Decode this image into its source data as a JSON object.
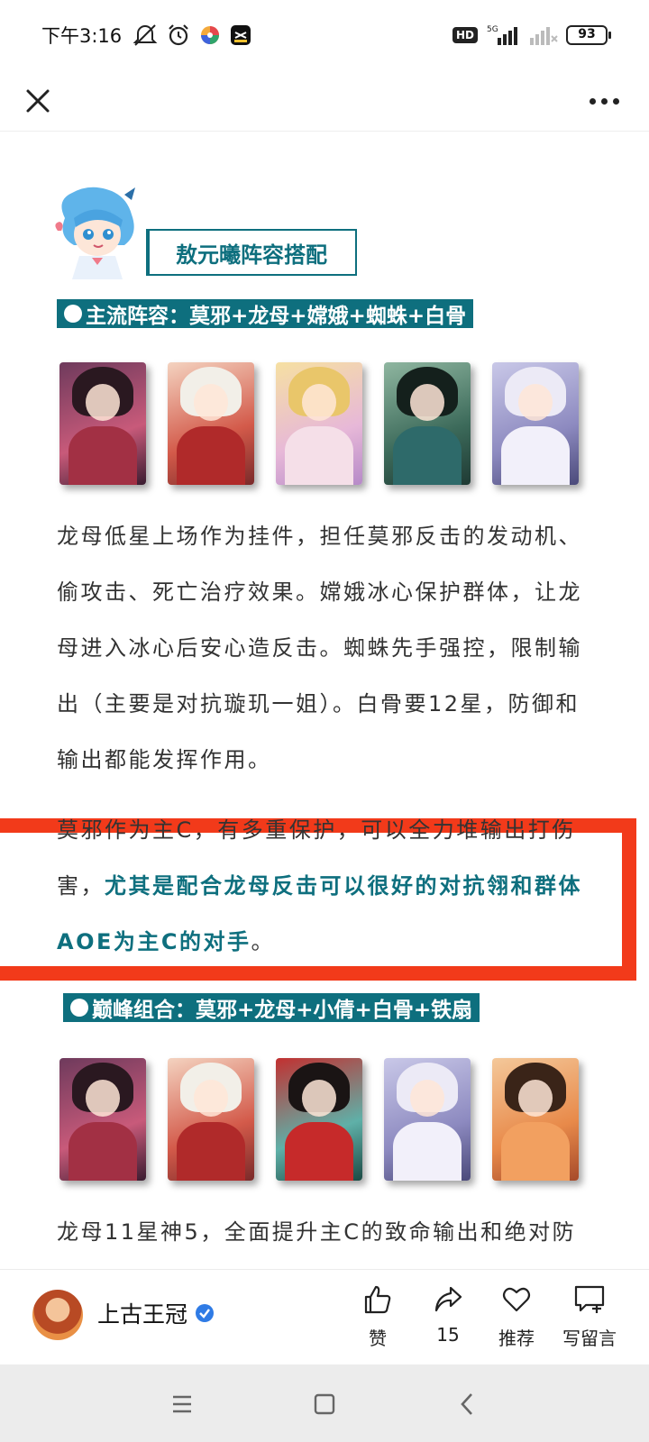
{
  "status_bar": {
    "time": "下午3:16",
    "network": "5G",
    "hd": "HD",
    "battery": "93"
  },
  "article": {
    "section_title": "敖元曦阵容搭配",
    "lineup1": {
      "title": "主流阵容：莫邪+龙母+嫦娥+蜘蛛+白骨",
      "cards": [
        "莫邪",
        "龙母",
        "嫦娥",
        "蜘蛛",
        "白骨"
      ]
    },
    "para1": "龙母低星上场作为挂件，担任莫邪反击的发动机、偷攻击、死亡治疗效果。嫦娥冰心保护群体，让龙母进入冰心后安心造反击。蜘蛛先手强控，限制输出（主要是对抗璇玑一姐）。白骨要12星，防御和输出都能发挥作用。",
    "para2_normal": "莫邪作为主C，有多重保护，可以全力堆输出打伤害，",
    "para2_highlight": "尤其是配合龙母反击可以很好的对抗翎和群体AOE为主C的对手",
    "para2_end": "。",
    "lineup2": {
      "title": " 巅峰组合：莫邪+龙母+小倩+白骨+铁扇",
      "cards": [
        "莫邪",
        "龙母",
        "小倩",
        "白骨",
        "铁扇"
      ]
    },
    "para3": "龙母11星神5，全面提升主C的致命输出和绝对防"
  },
  "bottom_bar": {
    "author_name": "上古王冠",
    "like_label": "赞",
    "share_count": "15",
    "recommend_label": "推荐",
    "comment_label": "写留言"
  },
  "colors": {
    "accent": "#0e6f7e",
    "highlight_box": "#f23a1a"
  }
}
